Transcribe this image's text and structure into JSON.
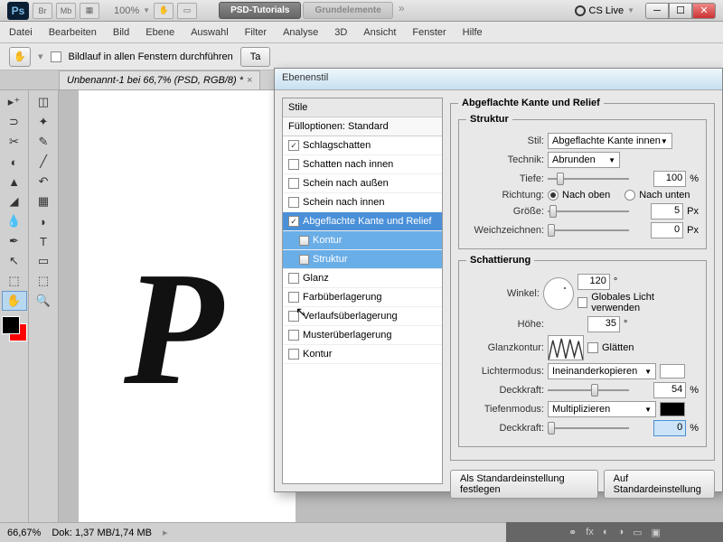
{
  "app": {
    "logo": "Ps",
    "zoom": "100%",
    "tabs": [
      {
        "label": "PSD-Tutorials",
        "active": true
      },
      {
        "label": "Grundelemente",
        "active": false
      }
    ],
    "cslive": "CS Live"
  },
  "menu": [
    "Datei",
    "Bearbeiten",
    "Bild",
    "Ebene",
    "Auswahl",
    "Filter",
    "Analyse",
    "3D",
    "Ansicht",
    "Fenster",
    "Hilfe"
  ],
  "optbar": {
    "scroll_all": "Bildlauf in allen Fenstern durchführen",
    "ta": "Ta"
  },
  "doc": {
    "title": "Unbenannt-1 bei 66,7% (PSD, RGB/8) *"
  },
  "dialog": {
    "title": "Ebenenstil",
    "styles_header": "Stile",
    "fill_opts": "Fülloptionen: Standard",
    "items": [
      {
        "label": "Schlagschatten",
        "checked": true
      },
      {
        "label": "Schatten nach innen",
        "checked": false
      },
      {
        "label": "Schein nach außen",
        "checked": false
      },
      {
        "label": "Schein nach innen",
        "checked": false
      },
      {
        "label": "Abgeflachte Kante und Relief",
        "checked": true,
        "selected": true
      },
      {
        "label": "Kontur",
        "sub": true
      },
      {
        "label": "Struktur",
        "sub": true
      },
      {
        "label": "Glanz",
        "checked": false
      },
      {
        "label": "Farbüberlagerung",
        "checked": false
      },
      {
        "label": "Verlaufsüberlagerung",
        "checked": false
      },
      {
        "label": "Musterüberlagerung",
        "checked": false
      },
      {
        "label": "Kontur",
        "checked": false
      }
    ],
    "panel_title": "Abgeflachte Kante und Relief",
    "struktur": {
      "legend": "Struktur",
      "stil_label": "Stil:",
      "stil_value": "Abgeflachte Kante innen",
      "technik_label": "Technik:",
      "technik_value": "Abrunden",
      "tiefe_label": "Tiefe:",
      "tiefe_value": "100",
      "tiefe_unit": "%",
      "richtung_label": "Richtung:",
      "richtung_up": "Nach oben",
      "richtung_down": "Nach unten",
      "groesse_label": "Größe:",
      "groesse_value": "5",
      "groesse_unit": "Px",
      "weich_label": "Weichzeichnen:",
      "weich_value": "0",
      "weich_unit": "Px"
    },
    "schatt": {
      "legend": "Schattierung",
      "winkel_label": "Winkel:",
      "winkel_value": "120",
      "deg": "°",
      "global": "Globales Licht verwenden",
      "hoehe_label": "Höhe:",
      "hoehe_value": "35",
      "glanzk_label": "Glanzkontur:",
      "glaetten": "Glätten",
      "lichter_label": "Lichtermodus:",
      "lichter_value": "Ineinanderkopieren",
      "deck1_label": "Deckkraft:",
      "deck1_value": "54",
      "pct": "%",
      "tiefen_label": "Tiefenmodus:",
      "tiefen_value": "Multiplizieren",
      "deck2_label": "Deckkraft:",
      "deck2_value": "0"
    },
    "btn_default": "Als Standardeinstellung festlegen",
    "btn_reset": "Auf Standardeinstellung"
  },
  "status": {
    "zoom": "66,67%",
    "doc": "Dok: 1,37 MB/1,74 MB"
  },
  "canvas_letter": "P"
}
